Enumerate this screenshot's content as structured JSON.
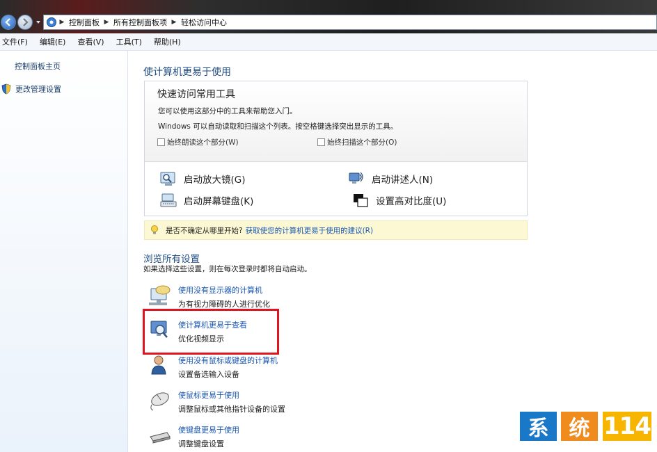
{
  "breadcrumb": [
    "控制面板",
    "所有控制面板项",
    "轻松访问中心"
  ],
  "menu": [
    "文件(F)",
    "编辑(E)",
    "查看(V)",
    "工具(T)",
    "帮助(H)"
  ],
  "sidebar": {
    "home": "控制面板主页",
    "admin": "更改管理设置"
  },
  "main": {
    "title": "使计算机更易于使用",
    "quick": {
      "title": "快速访问常用工具",
      "desc1": "您可以使用这部分中的工具来帮助您入门。",
      "desc2": "Windows 可以自动读取和扫描这个列表。按空格键选择突出显示的工具。",
      "check_read": "始终朗读这个部分(W)",
      "check_scan": "始终扫描这个部分(O)",
      "tools": {
        "magnifier": "启动放大镜(G)",
        "narrator": "启动讲述人(N)",
        "osk": "启动屏幕键盘(K)",
        "contrast": "设置高对比度(U)"
      }
    },
    "tip": {
      "question": "是否不确定从哪里开始?",
      "link": "获取使您的计算机更易于使用的建议(R)"
    },
    "browse": {
      "title": "浏览所有设置",
      "desc": "如果选择这些设置，则在每次登录时都将自动启动。",
      "items": [
        {
          "link": "使用没有显示器的计算机",
          "desc": "为有视力障碍的人进行优化"
        },
        {
          "link": "使计算机更易于查看",
          "desc": "优化视频显示"
        },
        {
          "link": "使用没有鼠标或键盘的计算机",
          "desc": "设置备选输入设备"
        },
        {
          "link": "使鼠标更易于使用",
          "desc": "调整鼠标或其他指针设备的设置"
        },
        {
          "link": "使键盘更易于使用",
          "desc": "调整键盘设置"
        }
      ]
    }
  },
  "watermark": [
    "系",
    "统",
    "114"
  ],
  "colors": {
    "link": "#1a57b3",
    "heading": "#1e4a82",
    "highlight": "#e0141e",
    "tip_bg": "#fcf8d3"
  }
}
